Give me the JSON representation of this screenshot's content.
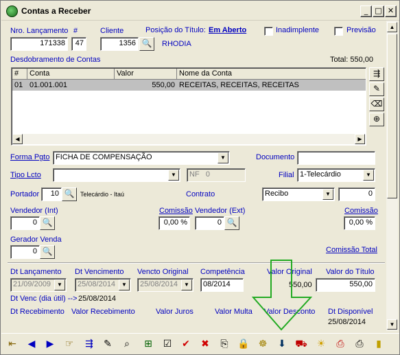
{
  "window": {
    "title": "Contas a Receber"
  },
  "header": {
    "nro_lancamento_label": "Nro. Lançamento",
    "hash_label": "#",
    "cliente_label": "Cliente",
    "posicao_label": "Posição do Título:",
    "posicao_value": "Em Aberto",
    "inadimplente_label": "Inadimplente",
    "previsao_label": "Previsão",
    "nro_lancamento": "171338",
    "hash_value": "47",
    "cliente_code": "1356",
    "cliente_name": "RHODIA"
  },
  "desdobramento": {
    "title": "Desdobramento de Contas",
    "total": "Total: 550,00",
    "columns": [
      "#",
      "Conta",
      "Valor",
      "Nome da Conta"
    ],
    "rows": [
      {
        "num": "01",
        "conta": "01.001.001",
        "valor": "550,00",
        "nome": "RECEITAS, RECEITAS, RECEITAS"
      }
    ]
  },
  "form": {
    "forma_pgto_label": "Forma Pgto",
    "forma_pgto_value": "FICHA DE COMPENSAÇÃO",
    "documento_label": "Documento",
    "documento_value": "",
    "tipo_lcto_label": "Tipo Lcto",
    "tipo_lcto_value": "",
    "nf_label": "NF",
    "nf_value": "0",
    "filial_label": "Filial",
    "filial_value": "1-Telecárdio",
    "portador_label": "Portador",
    "portador_value": "10",
    "portador_name": "Telecárdio - Itaú",
    "contrato_label": "Contrato",
    "contrato_value": "Recibo",
    "contrato_num": "0",
    "vendedor_int_label": "Vendedor (Int)",
    "vendedor_int_value": "0",
    "comissao_label": "Comissão",
    "comissao_int_value": "0,00 %",
    "vendedor_ext_label": "Vendedor (Ext)",
    "vendedor_ext_value": "0",
    "comissao_ext_label": "Comissão",
    "comissao_ext_value": "0,00 %",
    "gerador_venda_label": "Gerador Venda",
    "gerador_venda_value": "0",
    "comissao_total_label": "Comissão Total"
  },
  "dates": {
    "dt_lancamento_label": "Dt Lançamento",
    "dt_lancamento_value": "21/09/2009",
    "dt_vencimento_label": "Dt Vencimento",
    "dt_vencimento_value": "25/08/2014",
    "vencto_original_label": "Vencto Original",
    "vencto_original_value": "25/08/2014",
    "competencia_label": "Competência",
    "competencia_value": "08/2014",
    "valor_original_label": "Valor Original",
    "valor_original_value": "550,00",
    "valor_titulo_label": "Valor do Título",
    "valor_titulo_value": "550,00",
    "dt_venc_util_label": "Dt Venc (dia útil) -->",
    "dt_venc_util_value": "25/08/2014",
    "dt_recebimento_label": "Dt Recebimento",
    "valor_recebimento_label": "Valor Recebimento",
    "valor_juros_label": "Valor Juros",
    "valor_multa_label": "Valor Multa",
    "valor_desconto_label": "Valor Desconto",
    "dt_disponivel_label": "Dt Disponível",
    "dt_disponivel_value": "25/08/2014"
  },
  "colors": {
    "label_blue": "#0000c0",
    "arrow_green": "#22aa22",
    "selected_row": "#c0c0c0"
  },
  "toolbar_icons": [
    "exit-icon",
    "prev-icon",
    "next-icon",
    "point-icon",
    "split-icon",
    "doc-edit-icon",
    "doc-search-icon",
    "tree-icon",
    "list-check-icon",
    "confirm-icon",
    "cancel-icon",
    "copy-icon",
    "lock-icon",
    "handshake-icon",
    "receive-icon",
    "car-icon",
    "sun-icon",
    "print-icon",
    "printer-icon",
    "book-icon"
  ]
}
